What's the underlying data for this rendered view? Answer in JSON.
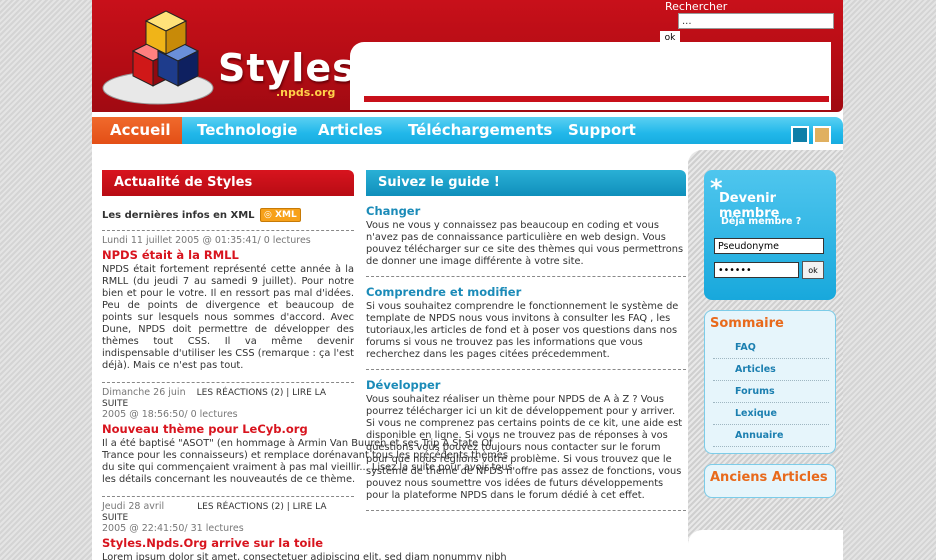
{
  "colors": {
    "brand_red": "#c8101a",
    "nav_blue": "#22b8ea",
    "accent_orange": "#e86a1c",
    "link_blue": "#1b8bb8"
  },
  "header": {
    "logo_text": "Styles",
    "logo_sub": ".npds.org",
    "search_label": "Rechercher",
    "search_value": "...",
    "search_button": "ok"
  },
  "nav": {
    "items": [
      "Accueil",
      "Technologie",
      "Articles",
      "Téléchargements",
      "Support"
    ],
    "active": "Accueil"
  },
  "news": {
    "title": "Actualité de Styles",
    "xml_line": "Les dernières infos en XML",
    "xml_badge": "XML",
    "items": [
      {
        "meta": "Lundi 11 juillet 2005 @ 01:35:41/ 0 lectures",
        "title": "NPDS était à la RMLL",
        "body": "NPDS était fortement représenté cette année à la RMLL (du jeudi 7 au samedi 9 juillet). Pour notre bien et pour le votre. Il en ressort pas mal d'idées. Peu de points de divergence et beaucoup de points sur lesquels nous sommes d'accord. Avec Dune, NPDS doit permettre de développer des thèmes tout CSS. Il va même devenir indispensable d'utiliser les CSS (remarque : ça l'est déjà). Mais ce n'est pas tout."
      },
      {
        "meta_date": "Dimanche 26 juin",
        "meta_links": "LES RÉACTIONS (2) | LIRE LA SUITE",
        "meta_time": "2005 @ 18:56:50/ 0 lectures",
        "title": "Nouveau thème pour LeCyb.org",
        "body": "Il a été baptisé \"ASOT\" (en hommage à Armin Van Buuren et ses Trip A State Of Trance pour les connaisseurs) et remplace dorénavant tous les précédents thèmes du site qui commençaient vraiment à pas mal vieillir... Lisez la suite pour avoir tous les détails concernant les nouveautés de ce thème."
      },
      {
        "meta_date": "Jeudi 28 avril",
        "meta_links": "LES RÉACTIONS (2) | LIRE LA SUITE",
        "meta_time": "2005 @ 22:41:50/ 31 lectures",
        "title": "Styles.Npds.Org arrive sur la toile",
        "body": "Lorem ipsum dolor sit amet, consectetuer adipiscing elit, sed diam nonummy nibh euismod tincidunt ut laoreet dolore magna aliquam erat volutpat. Ut wisi enim ad"
      }
    ]
  },
  "guide": {
    "title": "Suivez le guide !",
    "sections": [
      {
        "heading": "Changer",
        "body": "Vous ne vous y connaissez pas beaucoup en coding et vous n'avez pas de connaissance particulière en web design. Vous pouvez télécharger sur ce site des thèmes qui vous permettrons de donner une image différente à votre site."
      },
      {
        "heading": "Comprendre et modifier",
        "body": "Si vous souhaitez comprendre le fonctionnement le système de template de NPDS nous vous invitons à consulter les FAQ , les tutoriaux,les articles de fond et à poser vos questions dans nos forums si vous ne trouvez pas les informations que vous recherchez dans les pages citées précedemment."
      },
      {
        "heading": "Développer",
        "body": "Vous souhaitez réaliser un thème pour NPDS de A à Z ? Vous pourrez télécharger ici un kit de développement pour y arriver. Si vous ne comprenez pas certains points de ce kit, une aide est disponible en ligne. Si vous ne trouvez pas de réponses à vos questions vous pouvez toujours nous contacter sur le forum pour que nous réglions votre problème. Si vous trouvez que le système de thème de NPDS n'offre pas assez de fonctions, vous pouvez nous soumettre vos idées de futurs développements pour la plateforme NPDS dans le forum dédié à cet effet."
      }
    ]
  },
  "membre": {
    "star": "*",
    "title": "Devenir membre",
    "subtitle": "Déja membre ?",
    "user_value": "Pseudonyme",
    "pass_value": "••••••",
    "ok": "ok"
  },
  "sommaire": {
    "title": "Sommaire",
    "items": [
      "FAQ",
      "Articles",
      "Forums",
      "Lexique",
      "Annuaire"
    ]
  },
  "anciens": {
    "title": "Anciens Articles"
  }
}
